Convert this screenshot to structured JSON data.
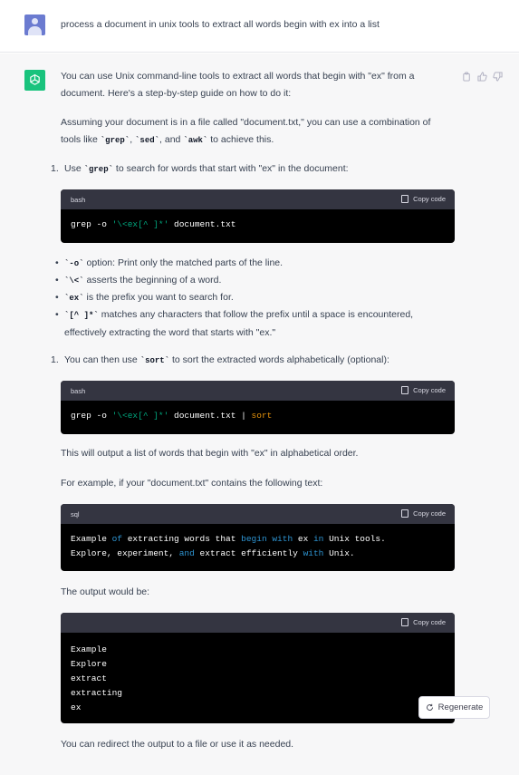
{
  "user": {
    "message": "process a document in unix tools to extract all words begin with ex into a list"
  },
  "assistant": {
    "intro": "You can use Unix command-line tools to extract all words that begin with \"ex\" from a document. Here's a step-by-step guide on how to do it:",
    "assume_pre": "Assuming your document is in a file called \"document.txt,\" you can use a combination of tools like ",
    "assume_tools": [
      "`grep`",
      "`sed`",
      "`awk`"
    ],
    "assume_sep1": ", ",
    "assume_sep2": ", and ",
    "assume_post": " to achieve this.",
    "step1": {
      "num": "1.",
      "pre": "Use ",
      "code": "`grep`",
      "post": " to search for words that start with \"ex\" in the document:"
    },
    "code1": {
      "lang": "bash",
      "copy_label": "Copy code",
      "cmd": "grep -o ",
      "arg": "'\\<ex[^ ]*'",
      "file": " document.txt"
    },
    "bullets": [
      {
        "code": "`-o`",
        "text": " option: Print only the matched parts of the line."
      },
      {
        "code": "`\\<`",
        "text": " asserts the beginning of a word."
      },
      {
        "code": "`ex`",
        "text": " is the prefix you want to search for."
      },
      {
        "code": "`[^ ]*`",
        "text": " matches any characters that follow the prefix until a space is encountered, effectively extracting the word that starts with \"ex.\""
      }
    ],
    "step2": {
      "num": "1.",
      "pre": "You can then use ",
      "code": "`sort`",
      "post": " to sort the extracted words alphabetically (optional):"
    },
    "code2": {
      "lang": "bash",
      "copy_label": "Copy code",
      "cmd": "grep -o ",
      "arg": "'\\<ex[^ ]*'",
      "file": " document.txt | ",
      "sort": "sort"
    },
    "output_note": "This will output a list of words that begin with \"ex\" in alphabetical order.",
    "example_note": "For example, if your \"document.txt\" contains the following text:",
    "code3": {
      "lang": "sql",
      "copy_label": "Copy code",
      "line1": [
        "Example ",
        "of",
        " extracting words that ",
        "begin",
        " ",
        "with",
        " ex ",
        "in",
        " Unix tools."
      ],
      "line2": [
        "Explore, experiment, ",
        "and",
        " extract efficiently ",
        "with",
        " Unix."
      ]
    },
    "output_label": "The output would be:",
    "code4": {
      "copy_label": "Copy code",
      "lines": [
        "Example",
        "Explore",
        "extract",
        "extracting",
        "ex"
      ]
    },
    "closing": "You can redirect the output to a file or use it as needed."
  },
  "regenerate_label": "Regenerate",
  "colors": {
    "bot_avatar": "#19c37d",
    "user_avatar": "#6b7bd0",
    "code_header": "#343541",
    "code_bg": "#000000",
    "token_string": "#00a67d",
    "token_keyword": "#2e95d3",
    "token_builtin": "#e9950c"
  }
}
